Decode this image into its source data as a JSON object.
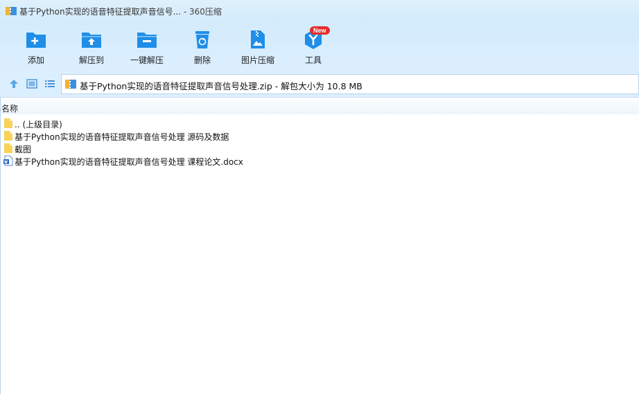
{
  "window": {
    "title": "基于Python实现的语音特征提取声音信号...",
    "app_suffix": " - 360压缩"
  },
  "toolbar": {
    "items": [
      {
        "label": "添加",
        "icon": "folder-add-icon"
      },
      {
        "label": "解压到",
        "icon": "folder-extract-icon"
      },
      {
        "label": "一键解压",
        "icon": "folder-oneclick-extract-icon"
      },
      {
        "label": "删除",
        "icon": "trash-icon"
      },
      {
        "label": "图片压缩",
        "icon": "image-compress-icon"
      },
      {
        "label": "工具",
        "icon": "tools-icon",
        "badge": "New"
      }
    ]
  },
  "navbar": {
    "path_text": "基于Python实现的语音特征提取声音信号处理.zip - 解包大小为 10.8 MB"
  },
  "file_list": {
    "column_name": "名称",
    "rows": [
      {
        "name": ".. (上级目录)",
        "type": "parent-folder"
      },
      {
        "name": "基于Python实现的语音特征提取声音信号处理 源码及数据",
        "type": "folder"
      },
      {
        "name": "截图",
        "type": "folder"
      },
      {
        "name": "基于Python实现的语音特征提取声音信号处理 课程论文.docx",
        "type": "word-doc"
      }
    ]
  },
  "colors": {
    "accent_blue": "#1f8ee8",
    "folder_yellow": "#f7d35a",
    "badge_red": "#e52b2b"
  }
}
